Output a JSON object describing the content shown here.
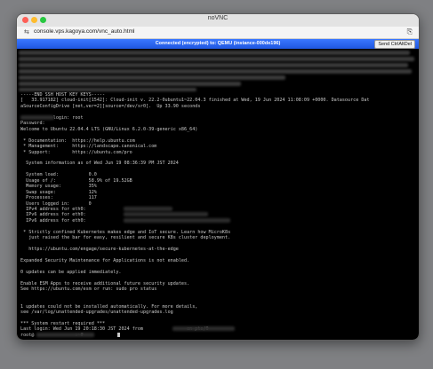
{
  "window": {
    "title": "noVNC",
    "url": "console.vps.kagoya.com/vnc_auto.html"
  },
  "novnc": {
    "status": "Connected (encrypted) to: QEMU (instance-000de196)",
    "ctrl_alt_del_label": "Send CtrlAltDel"
  },
  "terminal": {
    "lines": [
      "-----END SSH HOST KEY KEYS-----",
      "[   33.917182] cloud-init[1542]: Cloud-init v. 22.2-0ubuntu1~22.04.3 finished at Wed, 19 Jun 2024 11:08:09 +0000. Datasource Dat",
      "aSourceConfigDrive [net,ver=2][source=/dev/sr0].  Up 33.90 seconds",
      "",
      "            login: root",
      "Password:",
      "Welcome to Ubuntu 22.04.4 LTS (GNU/Linux 6.2.0-39-generic x86_64)",
      "",
      " * Documentation:  https://help.ubuntu.com",
      " * Management:     https://landscape.canonical.com",
      " * Support:        https://ubuntu.com/pro",
      "",
      "  System information as of Wed Jun 19 08:36:39 PM JST 2024",
      "",
      "  System load:           0.0",
      "  Usage of /:            58.9% of 19.52GB",
      "  Memory usage:          35%",
      "  Swap usage:            12%",
      "  Processes:             117",
      "  Users logged in:       0",
      "  IPv4 address for eth0: ",
      "  IPv6 address for eth0: ",
      "  IPv6 address for eth0: ",
      "",
      " * Strictly confined Kubernetes makes edge and IoT secure. Learn how MicroK8s",
      "   just raised the bar for easy, resilient and secure K8s cluster deployment.",
      "",
      "   https://ubuntu.com/engage/secure-kubernetes-at-the-edge",
      "",
      "Expanded Security Maintenance for Applications is not enabled.",
      "",
      "0 updates can be applied immediately.",
      "",
      "Enable ESM Apps to receive additional future security updates.",
      "See https://ubuntu.com/esm or run: sudo pro status",
      "",
      "",
      "1 updates could not be installed automatically. For more details,",
      "see /var/log/unattended-upgrades/unattended-upgrades.log",
      "",
      "*** System restart required ***",
      "Last login: Wed Jun 19 20:18:30 JST 2024 from                on pts/0",
      "root@               :~# "
    ]
  }
}
